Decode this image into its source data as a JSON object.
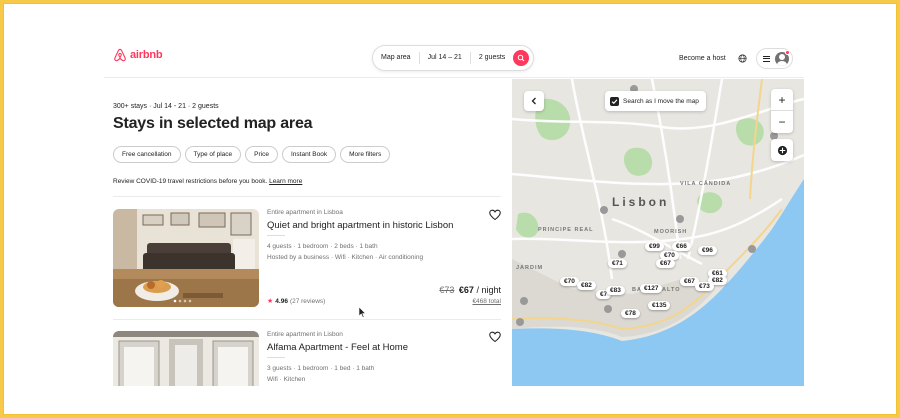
{
  "brand": {
    "name": "airbnb",
    "color": "#ff385c"
  },
  "search": {
    "location": "Map area",
    "dates": "Jul 14 – 21",
    "guests": "2 guests",
    "icon": "search-icon"
  },
  "header": {
    "host_label": "Become a host",
    "globe_icon": "globe-icon",
    "menu_icon": "menu-icon",
    "avatar_icon": "user-avatar-icon"
  },
  "results": {
    "meta": "300+ stays · Jul 14 - 21 · 2 guests",
    "title": "Stays in selected map area",
    "filters": [
      "Free cancellation",
      "Type of place",
      "Price",
      "Instant Book",
      "More filters"
    ],
    "covid_text": "Review COVID-19 travel restrictions before you book.",
    "covid_link": "Learn more"
  },
  "listings": [
    {
      "type": "Entire apartment in Lisboa",
      "name": "Quiet and bright apartment in historic Lisbon",
      "amenities_1": "4 guests · 1 bedroom · 2 beds · 1 bath",
      "amenities_2": "Hosted by a business · Wifi · Kitchen · Air conditioning",
      "rating": "4.96",
      "reviews": "(27 reviews)",
      "old_price": "€73",
      "price": "€67",
      "per": "/ night",
      "total": "€468 total"
    },
    {
      "type": "Entire apartment in Lisbon",
      "name": "Alfama Apartment - Feel at Home",
      "amenities_1": "3 guests · 1 bedroom · 1 bed · 1 bath",
      "amenities_2": "Wifi · Kitchen"
    }
  ],
  "map": {
    "search_as_move": "Search as I move the map",
    "zoom_in": "+",
    "zoom_out": "−",
    "city": "Lisbon",
    "labels": [
      "VILA CÂNDIDA",
      "PRINCIPE REAL",
      "JARDIM",
      "MOORISH",
      "BAIRRO ALTO"
    ],
    "prices": [
      "€99",
      "€66",
      "€70",
      "€96",
      "€71",
      "€67",
      "€70",
      "€82",
      "€7",
      "€83",
      "€127",
      "€67",
      "€61",
      "€82",
      "€73",
      "€135",
      "€78"
    ],
    "colors": {
      "land": "#e8e6e1",
      "water": "#8dc8f2",
      "park": "#b8dcaa"
    }
  }
}
